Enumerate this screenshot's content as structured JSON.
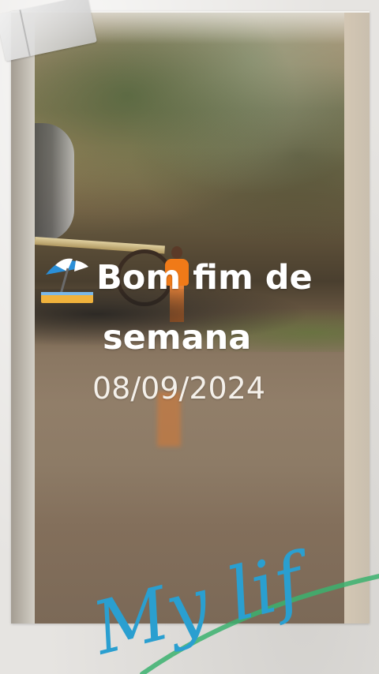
{
  "post": {
    "headline_line1": "Bom fim de",
    "headline_line2": "semana",
    "date": "08/09/2024",
    "signature": "My lif"
  },
  "colors": {
    "text": "#ffffff",
    "signature": "#2a9fd0",
    "accent_stroke": "#3bb26e",
    "shirt": "#f07a18"
  },
  "icons": {
    "umbrella": "beach-umbrella-icon",
    "tape": "tape-sticker"
  }
}
